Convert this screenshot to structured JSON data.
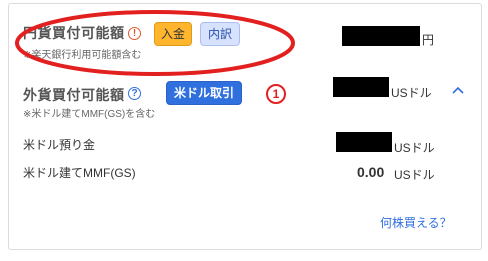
{
  "yen": {
    "title": "円貨買付可能額",
    "note": "※楽天銀行利用可能額含む",
    "info_icon": "!",
    "deposit_button": "入金",
    "details_button": "内訳",
    "unit": "円"
  },
  "foreign": {
    "title": "外貨買付可能額",
    "note": "※米ドル建てMMF(GS)を含む",
    "info_icon": "?",
    "usd_trade_button": "米ドル取引",
    "annotation": "1",
    "unit": "USドル"
  },
  "rows": [
    {
      "label": "米ドル預り金",
      "value": "",
      "unit": "USドル"
    },
    {
      "label": "米ドル建てMMF(GS)",
      "value": "0.00",
      "unit": "USドル"
    }
  ],
  "footer": {
    "link": "何株買える？"
  },
  "colors": {
    "annotation_red": "#e32020",
    "accent_blue": "#2f6fde",
    "orange": "#ffb62e"
  },
  "icons": {
    "collapse": "chevron-up-icon"
  }
}
